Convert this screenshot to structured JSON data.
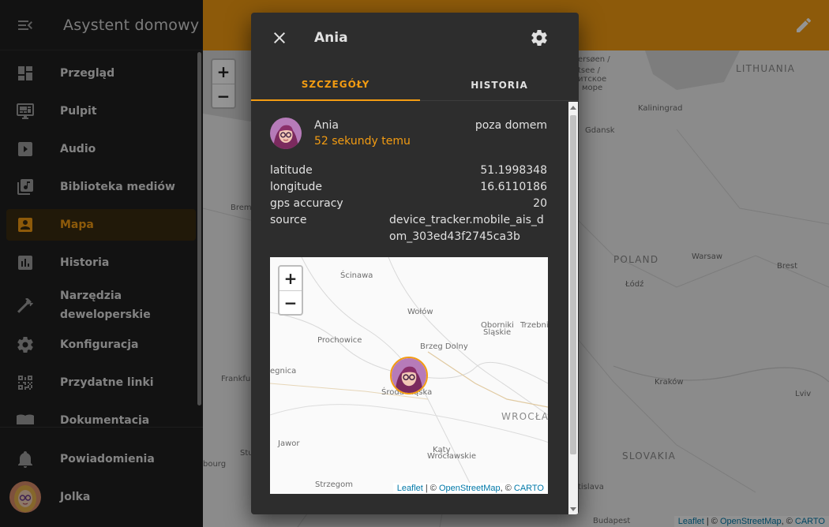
{
  "app": {
    "title": "Asystent domowy"
  },
  "sidebar": {
    "items": [
      {
        "label": "Przegląd",
        "icon": "dashboard-icon"
      },
      {
        "label": "Pulpit",
        "icon": "monitor-dashboard-icon"
      },
      {
        "label": "Audio",
        "icon": "play-box-icon"
      },
      {
        "label": "Biblioteka mediów",
        "icon": "music-library-icon"
      },
      {
        "label": "Mapa",
        "icon": "account-box-icon"
      },
      {
        "label": "Historia",
        "icon": "chart-box-icon"
      },
      {
        "label": "Narzędzia",
        "label2": "deweloperskie",
        "icon": "hammer-icon"
      },
      {
        "label": "Konfiguracja",
        "icon": "gear-icon"
      },
      {
        "label": "Przydatne linki",
        "icon": "qrcode-icon"
      },
      {
        "label": "Dokumentacja",
        "icon": "book-icon"
      }
    ],
    "notifications_label": "Powiadomienia",
    "user_name": "Jolka"
  },
  "map": {
    "labels": [
      "ersøen /",
      "tsee /",
      "итское",
      "море",
      "LITHUANIA",
      "Kaliningrad",
      "Gdansk",
      "Bremen",
      "POLAND",
      "Warsaw",
      "Łódź",
      "Brest",
      "Frankfurt",
      "Kraków",
      "Lviv",
      "SLOVAKIA",
      "Stuttgart",
      "bourg",
      "tislava",
      "Budapest"
    ],
    "attribution": {
      "leaflet": "Leaflet",
      "osm": "OpenStreetMap",
      "carto": "CARTO"
    }
  },
  "dialog": {
    "title": "Ania",
    "tabs": {
      "details": "SZCZEGÓŁY",
      "history": "HISTORIA"
    },
    "entity": {
      "name": "Ania",
      "last_changed": "52 sekundy temu",
      "state": "poza domem"
    },
    "attributes": [
      {
        "key": "latitude",
        "value": "51.1998348"
      },
      {
        "key": "longitude",
        "value": "16.6110186"
      },
      {
        "key": "gps accuracy",
        "value": "20"
      },
      {
        "key": "source",
        "value": "device_tracker.mobile_ais_dom_303ed43f2745ca3b"
      }
    ],
    "mini_map": {
      "labels": [
        "Ścinawa",
        "Wołów",
        "Oborniki",
        "Śląskie",
        "Trzebni",
        "Prochowice",
        "Brzeg Dolny",
        "egnica",
        "Środa Śląska",
        "WROCŁA",
        "Jawor",
        "Kąty",
        "Wrocławskie",
        "Strzegom"
      ]
    }
  },
  "colors": {
    "accent": "#f39c12",
    "sidebar_bg": "#1f1f1f",
    "dialog_bg": "#2d2d2d"
  }
}
